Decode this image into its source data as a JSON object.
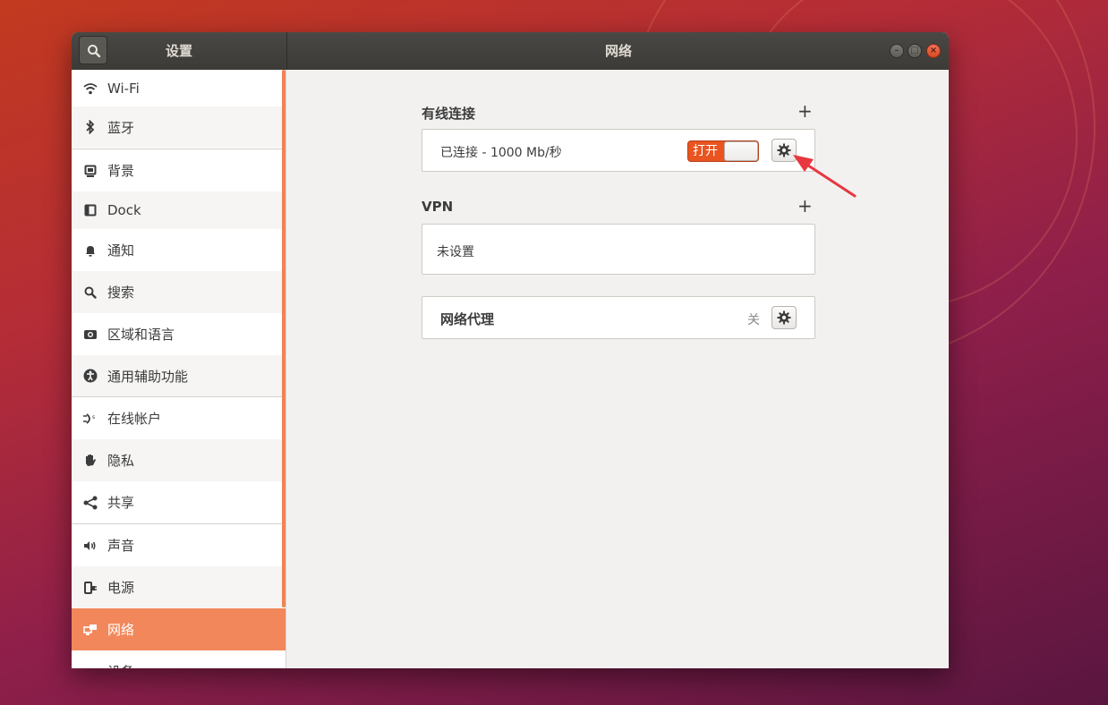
{
  "window": {
    "sidebar_title": "设置",
    "main_title": "网络"
  },
  "sidebar": {
    "items": [
      {
        "label": "Wi-Fi",
        "icon": "wifi-icon"
      },
      {
        "label": "蓝牙",
        "icon": "bluetooth-icon"
      },
      {
        "label": "背景",
        "icon": "background-icon"
      },
      {
        "label": "Dock",
        "icon": "dock-icon"
      },
      {
        "label": "通知",
        "icon": "bell-icon"
      },
      {
        "label": "搜索",
        "icon": "search-icon"
      },
      {
        "label": "区域和语言",
        "icon": "region-icon"
      },
      {
        "label": "通用辅助功能",
        "icon": "accessibility-icon"
      },
      {
        "label": "在线帐户",
        "icon": "online-accounts-icon"
      },
      {
        "label": "隐私",
        "icon": "hand-icon"
      },
      {
        "label": "共享",
        "icon": "share-icon"
      },
      {
        "label": "声音",
        "icon": "speaker-icon"
      },
      {
        "label": "电源",
        "icon": "power-plug-icon"
      },
      {
        "label": "网络",
        "icon": "network-icon"
      },
      {
        "label": "设备",
        "icon": "printer-icon"
      }
    ],
    "active": "网络"
  },
  "wired": {
    "title": "有线连接",
    "status": "已连接 - 1000 Mb/秒",
    "toggle_label": "打开"
  },
  "vpn": {
    "title": "VPN",
    "empty": "未设置"
  },
  "proxy": {
    "title": "网络代理",
    "state": "关"
  },
  "colors": {
    "accent": "#e95420",
    "active_row": "#f1875b",
    "annotation_arrow": "#e8373f"
  }
}
